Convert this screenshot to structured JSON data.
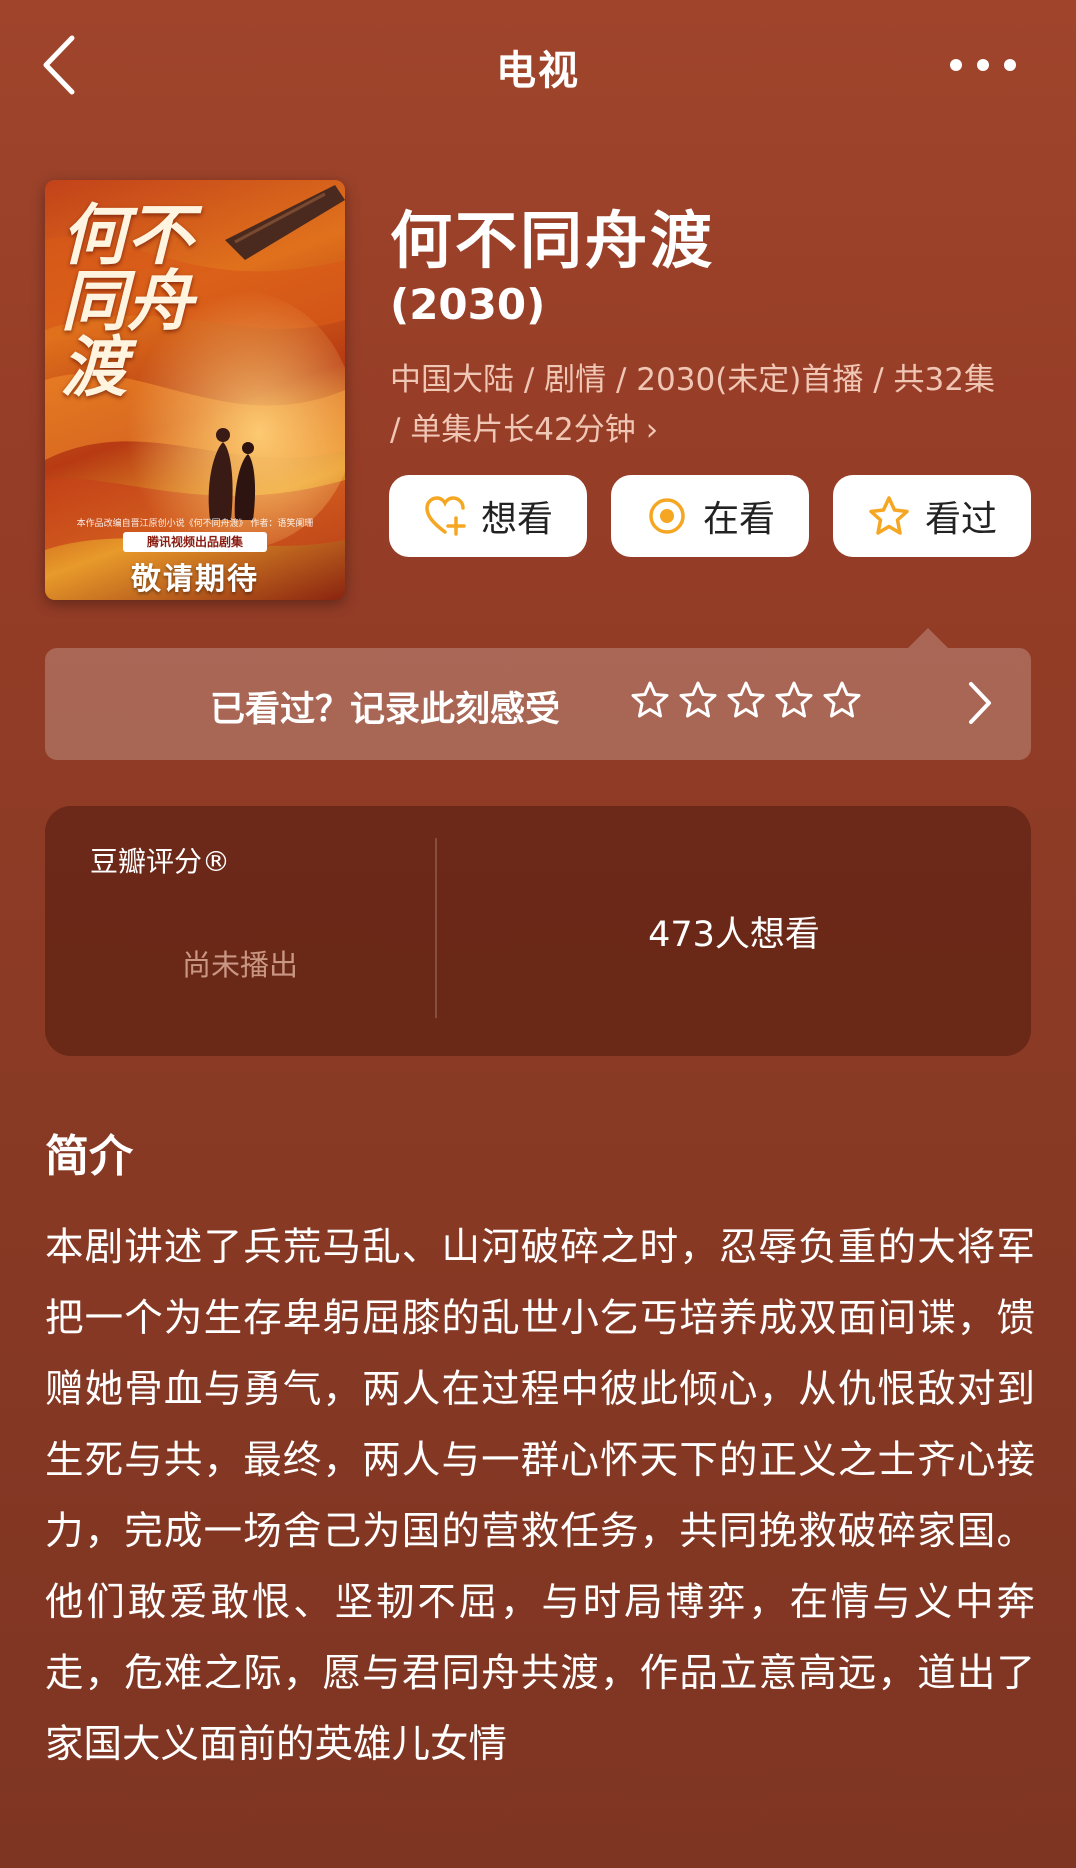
{
  "nav": {
    "title": "电视",
    "back_icon": "chevron-left-icon",
    "more_icon": "more-dots-icon"
  },
  "poster": {
    "calligraphy": "何不同舟渡",
    "credit": "本作品改编自晋江原创小说《何不同舟渡》 作者：语笑阑珊",
    "tag": "腾讯视频出品剧集",
    "expect": "敬请期待"
  },
  "title": "何不同舟渡",
  "year": "(2030)",
  "meta": {
    "text": "中国大陆 / 剧情 / 2030(未定)首播 / 共32集 / 单集片长42分钟",
    "chevron": "›"
  },
  "actions": {
    "want": "想看",
    "watching": "在看",
    "watched": "看过"
  },
  "rating_prompt": {
    "text": "已看过？记录此刻感受",
    "star_count": 5
  },
  "score": {
    "label": "豆瓣评分®",
    "status": "尚未播出",
    "wish": "473人想看"
  },
  "synopsis": {
    "title": "简介",
    "text": "本剧讲述了兵荒马乱、山河破碎之时，忍辱负重的大将军把一个为生存卑躬屈膝的乱世小乞丐培养成双面间谍，馈赠她骨血与勇气，两人在过程中彼此倾心，从仇恨敌对到生死与共，最终，两人与一群心怀天下的正义之士齐心接力，完成一场舍己为国的营救任务，共同挽救破碎家国。他们敢爱敢恨、坚韧不屈，与时局博弈，在情与义中奔走，危难之际，愿与君同舟共渡，作品立意高远，道出了家国大义面前的英雄儿女情"
  },
  "colors": {
    "background": "#963d27",
    "accent_orange": "#f5a623",
    "meta_text": "#f0c6b5"
  }
}
